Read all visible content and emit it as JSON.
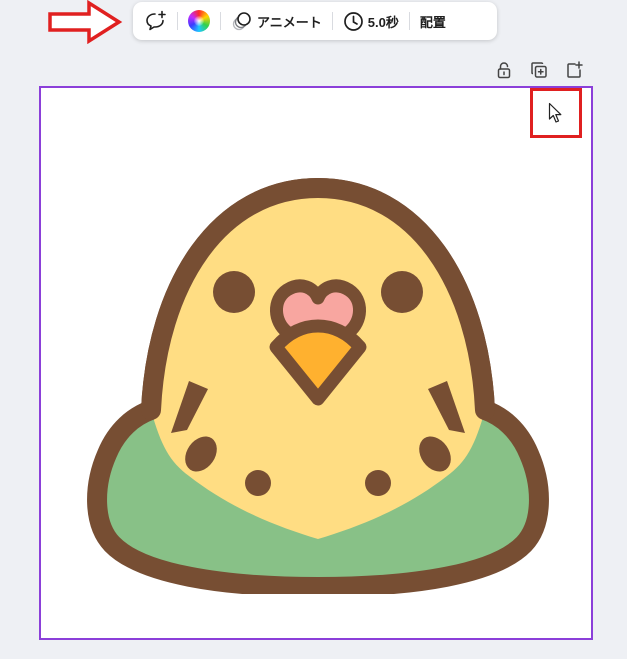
{
  "toolbar": {
    "animate_label": "アニメート",
    "duration_label": "5.0秒",
    "position_label": "配置"
  },
  "icons": {
    "comment": "comment-add-icon",
    "color": "color-wheel-icon",
    "animate": "animate-icon",
    "clock": "clock-icon",
    "lock": "lock-icon",
    "duplicate": "duplicate-icon",
    "add_page": "add-page-icon",
    "cursor": "mouse-cursor-icon"
  },
  "colors": {
    "selection_border": "#8b3fd9",
    "annotation_red": "#e02020",
    "budgie_outline": "#774e33",
    "budgie_yellow": "#ffdd83",
    "budgie_green": "#88c187",
    "budgie_beak": "#ffb12f",
    "budgie_cere": "#f8a6a0"
  }
}
